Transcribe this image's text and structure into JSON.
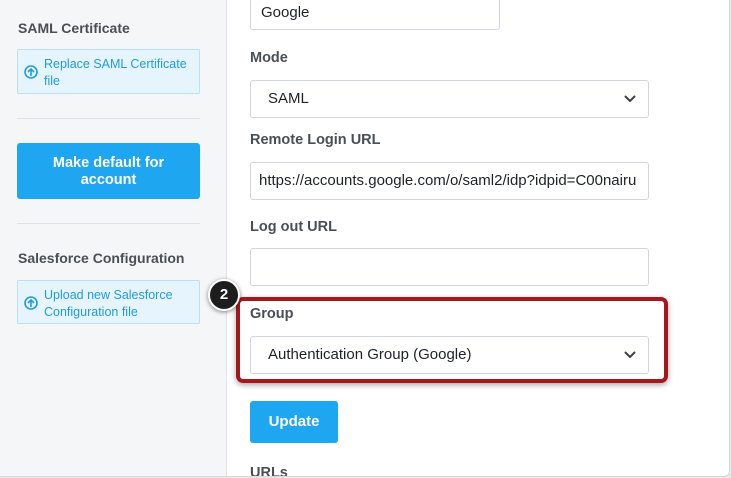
{
  "sidebar": {
    "saml_heading": "SAML Certificate",
    "replace_cert_link": "Replace SAML Certificate file",
    "make_default_button": "Make default for account",
    "salesforce_heading": "Salesforce Configuration",
    "upload_salesforce_link": "Upload new Salesforce Configuration file"
  },
  "form": {
    "name_value": "Google",
    "mode_label": "Mode",
    "mode_value": "SAML",
    "remote_login_label": "Remote Login URL",
    "remote_login_value": "https://accounts.google.com/o/saml2/idp?idpid=C00nairu",
    "logout_label": "Log out URL",
    "logout_value": "",
    "group_label": "Group",
    "group_value": "Authentication Group (Google)",
    "update_button": "Update",
    "urls_label": "URLs"
  },
  "annotation": {
    "step_number": "2",
    "highlight_color": "#a6161d"
  },
  "colors": {
    "accent": "#1ea6f1",
    "link": "#1f9ce0"
  }
}
